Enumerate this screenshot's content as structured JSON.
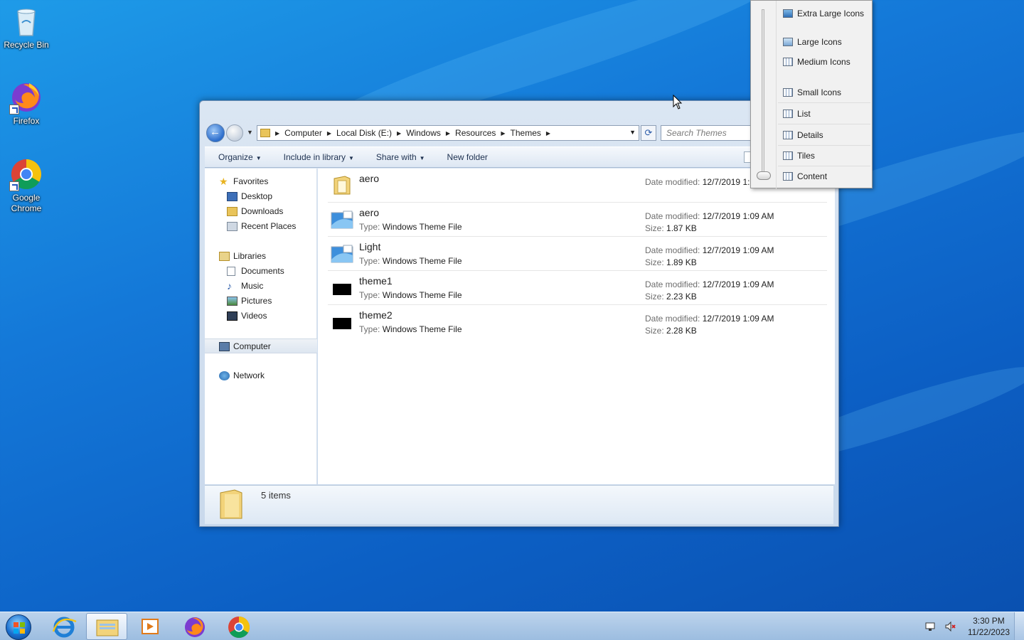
{
  "desktop": {
    "icons": [
      {
        "label": "Recycle Bin"
      },
      {
        "label": "Firefox"
      },
      {
        "label": "Google Chrome"
      }
    ]
  },
  "explorer": {
    "address": {
      "crumbs": [
        "Computer",
        "Local Disk (E:)",
        "Windows",
        "Resources",
        "Themes"
      ]
    },
    "search": {
      "placeholder": "Search Themes"
    },
    "toolbar": {
      "organize": "Organize",
      "include_in_library": "Include in library",
      "share_with": "Share with",
      "new_folder": "New folder"
    },
    "nav": {
      "favorites": "Favorites",
      "desktop": "Desktop",
      "downloads": "Downloads",
      "recent_places": "Recent Places",
      "libraries": "Libraries",
      "documents": "Documents",
      "music": "Music",
      "pictures": "Pictures",
      "videos": "Videos",
      "computer": "Computer",
      "network": "Network"
    },
    "labels": {
      "date_modified": "Date modified:",
      "type": "Type:",
      "size": "Size:"
    },
    "files": [
      {
        "name": "aero",
        "kind": "folder",
        "date": "12/7/2019 1:5",
        "type": "",
        "size": ""
      },
      {
        "name": "aero",
        "kind": "theme",
        "date": "12/7/2019 1:09 AM",
        "type": "Windows Theme File",
        "size": "1.87 KB"
      },
      {
        "name": "Light",
        "kind": "theme",
        "date": "12/7/2019 1:09 AM",
        "type": "Windows Theme File",
        "size": "1.89 KB"
      },
      {
        "name": "theme1",
        "kind": "theme-black",
        "date": "12/7/2019 1:09 AM",
        "type": "Windows Theme File",
        "size": "2.23 KB"
      },
      {
        "name": "theme2",
        "kind": "theme-black",
        "date": "12/7/2019 1:09 AM",
        "type": "Windows Theme File",
        "size": "2.28 KB"
      }
    ],
    "status": {
      "items_count": "5 items"
    }
  },
  "view_menu": {
    "items": [
      "Extra Large Icons",
      "Large Icons",
      "Medium Icons",
      "Small Icons",
      "List",
      "Details",
      "Tiles",
      "Content"
    ],
    "selected": "Content"
  },
  "taskbar": {
    "time": "3:30 PM",
    "date": "11/22/2023"
  },
  "colors": {
    "desktop_blue": "#1478d8",
    "window_frame": "#c9d9ec",
    "accent": "#2c6dcc"
  }
}
